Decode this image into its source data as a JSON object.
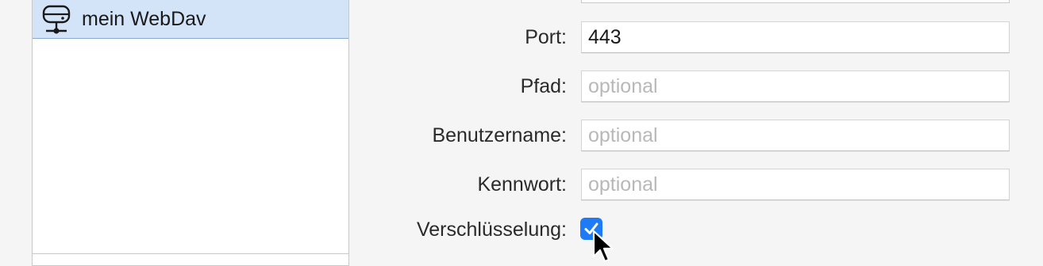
{
  "sidebar": {
    "items": [
      {
        "label": "mein WebDav",
        "icon": "network-drive-icon",
        "selected": true
      }
    ]
  },
  "form": {
    "port": {
      "label": "Port:",
      "value": "443"
    },
    "path": {
      "label": "Pfad:",
      "value": "",
      "placeholder": "optional"
    },
    "username": {
      "label": "Benutzername:",
      "value": "",
      "placeholder": "optional"
    },
    "password": {
      "label": "Kennwort:",
      "value": "",
      "placeholder": "optional"
    },
    "encryption": {
      "label": "Verschlüsselung:",
      "checked": true
    }
  },
  "colors": {
    "selection": "#d3e3f8",
    "checkbox_accent": "#1f7bf5",
    "background": "#f5f5f5"
  }
}
